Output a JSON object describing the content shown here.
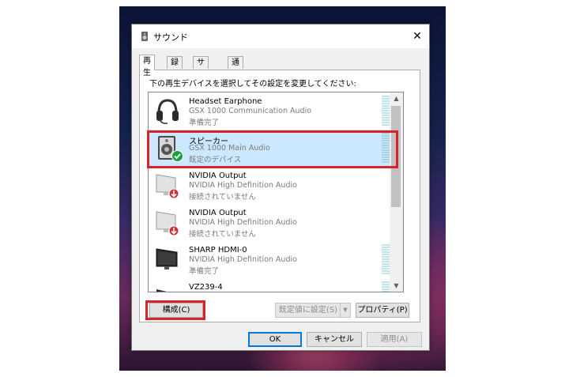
{
  "window": {
    "title": "サウンド",
    "close_glyph": "✕"
  },
  "tabs": [
    {
      "label": "再生",
      "active": true
    },
    {
      "label": "録音",
      "active": false
    },
    {
      "label": "サウンド",
      "active": false
    },
    {
      "label": "通信",
      "active": false
    }
  ],
  "instruction": "下の再生デバイスを選択してその設定を変更してください:",
  "devices": [
    {
      "name": "Headset Earphone",
      "driver": "GSX 1000 Communication Audio",
      "status": "準備完了",
      "icon": "headset-icon",
      "selected": false
    },
    {
      "name": "スピーカー",
      "driver": "GSX 1000 Main Audio",
      "status": "既定のデバイス",
      "icon": "speaker-icon",
      "selected": true
    },
    {
      "name": "NVIDIA Output",
      "driver": "NVIDIA High Definition Audio",
      "status": "接続されていません",
      "icon": "monitor-disconnected-icon",
      "selected": false
    },
    {
      "name": "NVIDIA Output",
      "driver": "NVIDIA High Definition Audio",
      "status": "接続されていません",
      "icon": "monitor-disconnected-icon",
      "selected": false
    },
    {
      "name": "SHARP HDMI-0",
      "driver": "NVIDIA High Definition Audio",
      "status": "準備完了",
      "icon": "monitor-icon",
      "selected": false
    },
    {
      "name": "VZ239-4",
      "driver": "",
      "status": "",
      "icon": "monitor-icon",
      "selected": false
    }
  ],
  "buttons": {
    "configure": "構成(C)",
    "set_default": "既定値に設定(S)",
    "properties": "プロパティ(P)",
    "ok": "OK",
    "cancel": "キャンセル",
    "apply": "適用(A)"
  },
  "colors": {
    "highlight": "#d9232b",
    "selection": "#cce8ff",
    "default_button": "#0078d7"
  }
}
